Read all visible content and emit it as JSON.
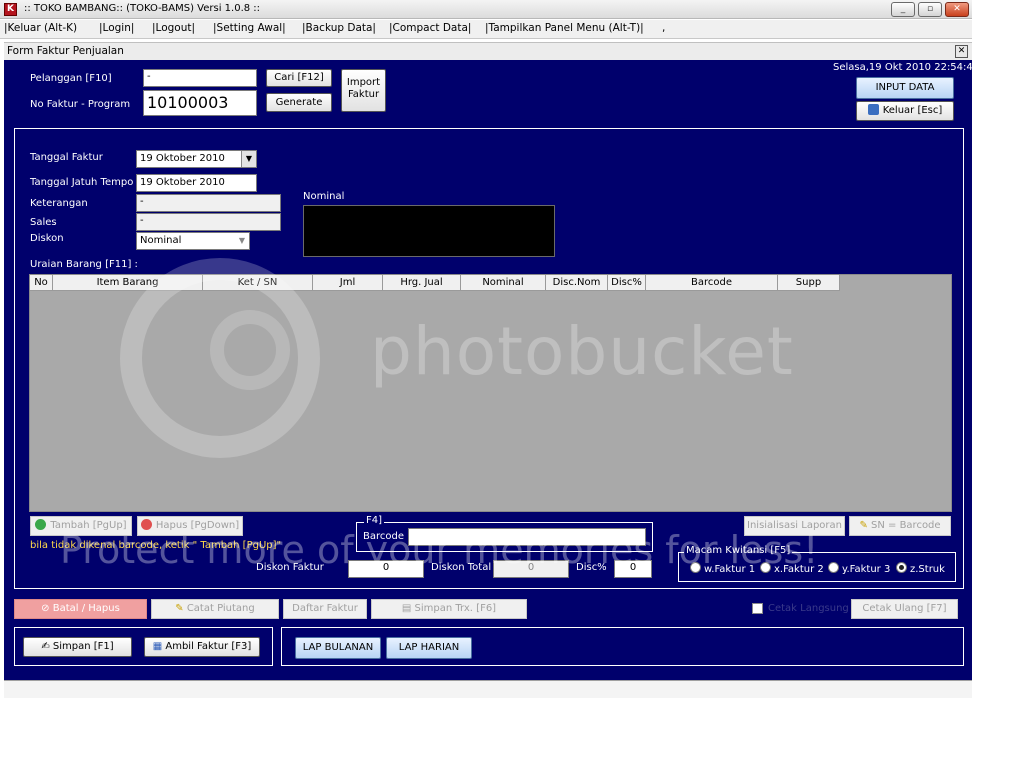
{
  "window": {
    "title": ":: TOKO BAMBANG:: (TOKO-BAMS) Versi 1.0.8 ::",
    "minimize_glyph": "_",
    "maximize_glyph": "▫",
    "close_glyph": "✕"
  },
  "menu": {
    "items": [
      "|Keluar (Alt-K)",
      "|Login|",
      "|Logout|",
      "|Setting Awal|",
      "|Backup Data|",
      "|Compact Data|",
      "|Tampilkan Panel Menu (Alt-T)|",
      ","
    ]
  },
  "form": {
    "title": "Form Faktur Penjualan",
    "close_glyph": "✕",
    "datetime": "Selasa,19 Okt 2010 22:54:49"
  },
  "header": {
    "pelanggan_label": "Pelanggan [F10]",
    "pelanggan_value": "-",
    "no_faktur_label": "No Faktur - Program",
    "no_faktur_value": "10100003",
    "cari_button": "Cari [F12]",
    "generate_button": "Generate",
    "import_button_line1": "Import",
    "import_button_line2": "Faktur",
    "input_data_button": "INPUT DATA",
    "keluar_button": "Keluar [Esc]"
  },
  "details": {
    "tanggal_faktur_label": "Tanggal Faktur",
    "tanggal_faktur_value": "19  Oktober  2010",
    "jatuh_tempo_label": "Tanggal Jatuh Tempo",
    "jatuh_tempo_value": "19 Oktober 2010",
    "keterangan_label": "Keterangan",
    "keterangan_value": "-",
    "sales_label": "Sales",
    "sales_value": "-",
    "diskon_label": "Diskon",
    "diskon_value": "Nominal",
    "nominal_label": "Nominal",
    "uraian_label": "Uraian Barang [F11] :"
  },
  "grid": {
    "columns": [
      "No",
      "Item Barang",
      "Ket / SN",
      "Jml",
      "Hrg. Jual",
      "Nominal",
      "Disc.Nom",
      "Disc%",
      "Barcode",
      "Supp"
    ]
  },
  "actions": {
    "tambah": "Tambah [PgUp]",
    "hapus": "Hapus [PgDown]",
    "barcode_group": "F4]",
    "barcode_label": "Barcode",
    "inisialisasi": "Inisialisasi Laporan",
    "sn_barcode": "SN = Barcode",
    "hint": "bila tidak dikenal barcode, ketik \" Tambah [PgUp]\"",
    "diskon_faktur_label": "Diskon Faktur",
    "diskon_faktur_value": "0",
    "diskon_total_label": "Diskon Total",
    "diskon_total_value": "0",
    "disc_pct_label": "Disc%",
    "disc_pct_value": "0",
    "kwitansi_label": "Macam Kwitansi [F5]",
    "kwitansi_options": [
      "w.Faktur 1",
      "x.Faktur 2",
      "y.Faktur 3",
      "z.Struk"
    ],
    "kwitansi_selected": 3
  },
  "toolbar": {
    "batal": "Batal / Hapus",
    "catat_piutang": "Catat Piutang",
    "daftar_faktur": "Daftar Faktur",
    "simpan_trx": "Simpan Trx. [F6]",
    "checkbox_label": "Cetak Langsung",
    "cetak_ulang": "Cetak Ulang [F7]"
  },
  "footer": {
    "simpan": "Simpan [F1]",
    "ambil_faktur": "Ambil Faktur [F3]",
    "lap_bulanan": "LAP BULANAN",
    "lap_harian": "LAP HARIAN"
  },
  "watermark": {
    "brand": "photobucket",
    "slogan": "Protect more of your memories for less!"
  },
  "colors": {
    "panel_blue": "#00006c",
    "grid_gray": "#a9a9a9",
    "batal_pink": "#f0a0a0",
    "hint_yellow": "#ffd94a"
  }
}
